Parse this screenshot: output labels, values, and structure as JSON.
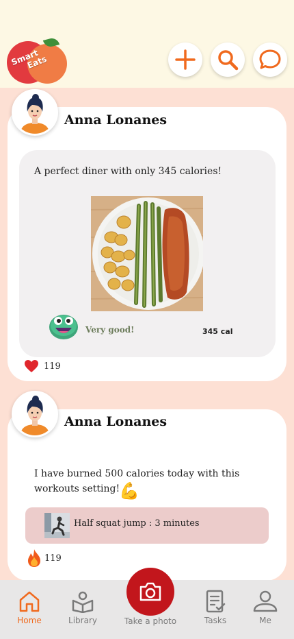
{
  "app": {
    "logo_line1": "Smart",
    "logo_line2": "Eats",
    "header_buttons": [
      {
        "name": "add",
        "icon": "plus-icon"
      },
      {
        "name": "search",
        "icon": "search-icon"
      },
      {
        "name": "messages",
        "icon": "chat-bubble-icon"
      }
    ],
    "accent_color": "#f06a1e"
  },
  "posts": [
    {
      "author": "Anna Lonanes",
      "text": "A perfect diner with only 345 calories!",
      "rating": "Very good!",
      "calories": "345 cal",
      "reaction_icon": "heart-icon",
      "reaction_count": "119"
    },
    {
      "author": "Anna Lonanes",
      "text_line1": "I have burned 500 calories today with this",
      "text_line2": "workouts setting!",
      "emoji": "💪",
      "workout": "Half squat jump : 3 minutes",
      "reaction_icon": "fire-icon",
      "reaction_count": "119"
    }
  ],
  "nav": {
    "items": [
      {
        "label": "Home",
        "icon": "home-icon",
        "active": true
      },
      {
        "label": "Library",
        "icon": "library-icon",
        "active": false
      },
      {
        "label": "Take a photo",
        "icon": "camera-icon",
        "active": false
      },
      {
        "label": "Tasks",
        "icon": "tasks-icon",
        "active": false
      },
      {
        "label": "Me",
        "icon": "user-icon",
        "active": false
      }
    ]
  }
}
